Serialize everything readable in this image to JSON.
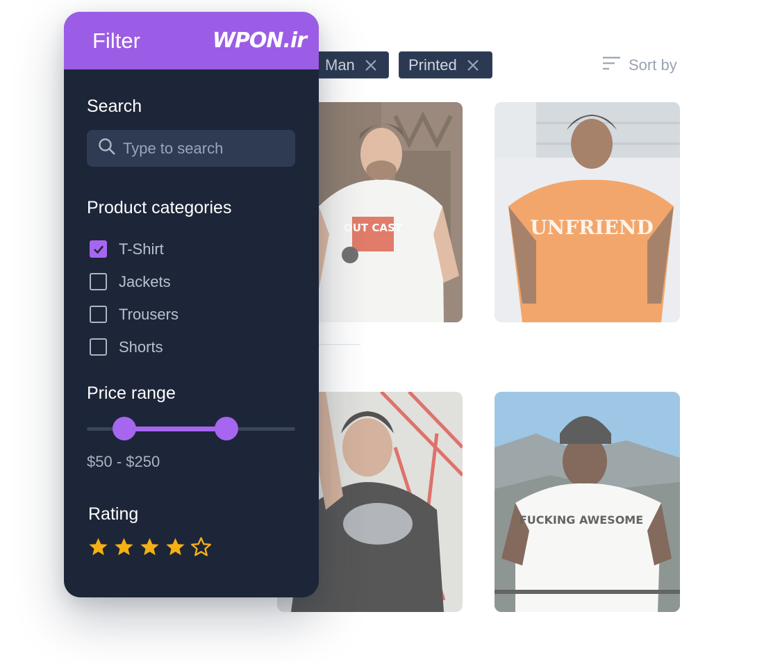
{
  "chips": [
    {
      "label": "Man"
    },
    {
      "label": "Printed"
    }
  ],
  "sort": {
    "label": "Sort by"
  },
  "filter": {
    "title": "Filter",
    "logo": "WPON.ir",
    "search": {
      "title": "Search",
      "placeholder": "Type to search",
      "value": ""
    },
    "categories": {
      "title": "Product categories",
      "items": [
        {
          "label": "T-Shirt",
          "checked": true
        },
        {
          "label": "Jackets",
          "checked": false
        },
        {
          "label": "Trousers",
          "checked": false
        },
        {
          "label": "Shorts",
          "checked": false
        }
      ]
    },
    "price": {
      "title": "Price range",
      "min_fraction": 0.18,
      "max_fraction": 0.67,
      "label": "$50 - $250"
    },
    "rating": {
      "title": "Rating",
      "value": 4,
      "max": 5
    }
  },
  "products": [
    {
      "shirt_text": "OUT CAST"
    },
    {
      "shirt_text": "UNFRIEND"
    },
    {
      "shirt_text": ""
    },
    {
      "shirt_text": "FUCKING AWESOME"
    }
  ],
  "colors": {
    "accent": "#9b5de5",
    "panel": "#1d2539",
    "star": "#f5b014"
  },
  "icons": [
    "close-icon",
    "sort-icon",
    "search-icon",
    "check-icon",
    "star-icon",
    "star-outline-icon"
  ]
}
